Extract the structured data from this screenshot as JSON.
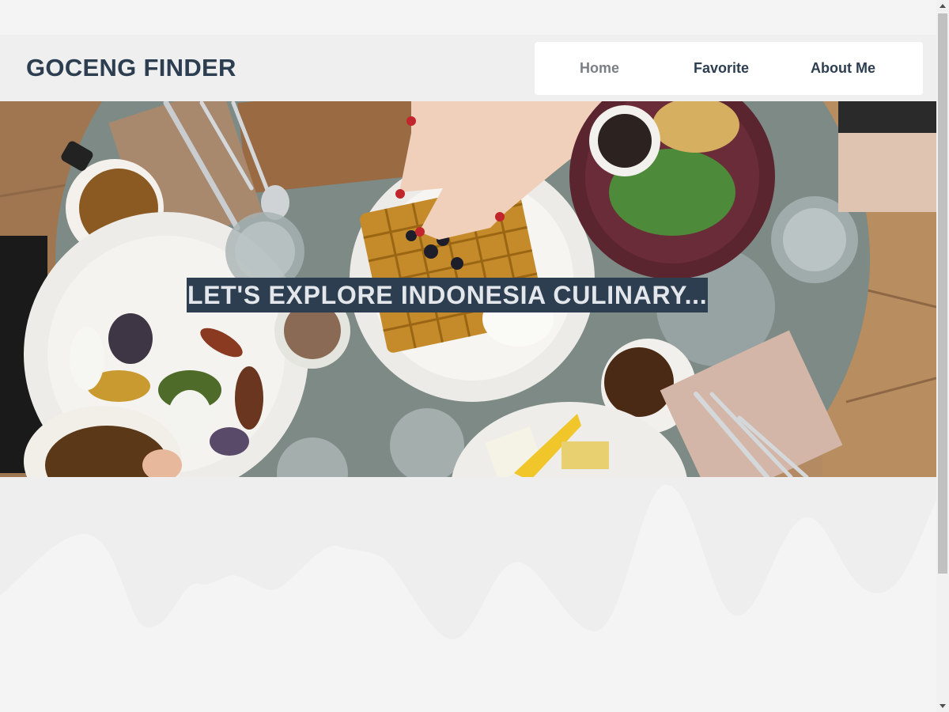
{
  "header": {
    "brand": "GOCENG FINDER",
    "nav": [
      {
        "label": "Home",
        "active": true
      },
      {
        "label": "Favorite",
        "active": false
      },
      {
        "label": "About Me",
        "active": false
      }
    ]
  },
  "hero": {
    "headline": "LET'S EXPLORE INDONESIA CULINARY..."
  },
  "colors": {
    "brand": "#2c3e50",
    "header_bg": "#efefef",
    "page_bg": "#f4f4f4",
    "wave_bg": "#eeeeee",
    "nav_active": "#7b7f84"
  },
  "icons": {
    "scroll_up": "triangle-up-icon",
    "scroll_down": "triangle-down-icon"
  }
}
